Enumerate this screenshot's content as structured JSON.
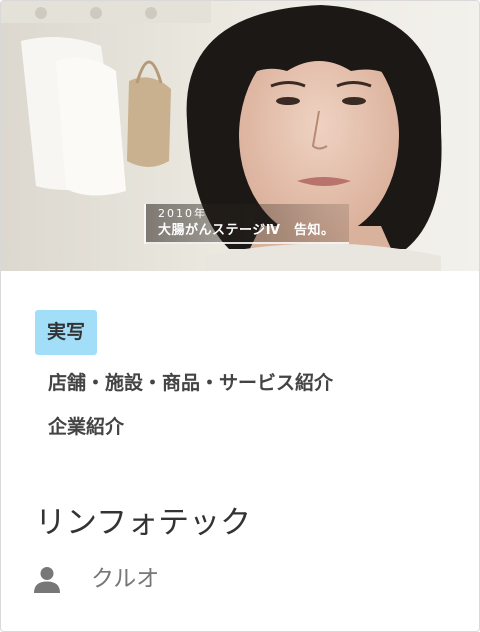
{
  "card": {
    "thumbnail": {
      "alt": "",
      "caption_year": "2010年",
      "caption_text": "大腸がんステージⅣ　告知。"
    },
    "tag": "実写",
    "categories": [
      "店舗・施設・商品・サービス紹介",
      "企業紹介"
    ],
    "title": "リンフォテック",
    "author": {
      "icon": "person-icon",
      "name": "クルオ"
    }
  },
  "colors": {
    "tag_background": "#a3def8",
    "title_text": "#333333",
    "author_text": "#777777",
    "card_border": "#d9d9d9"
  }
}
